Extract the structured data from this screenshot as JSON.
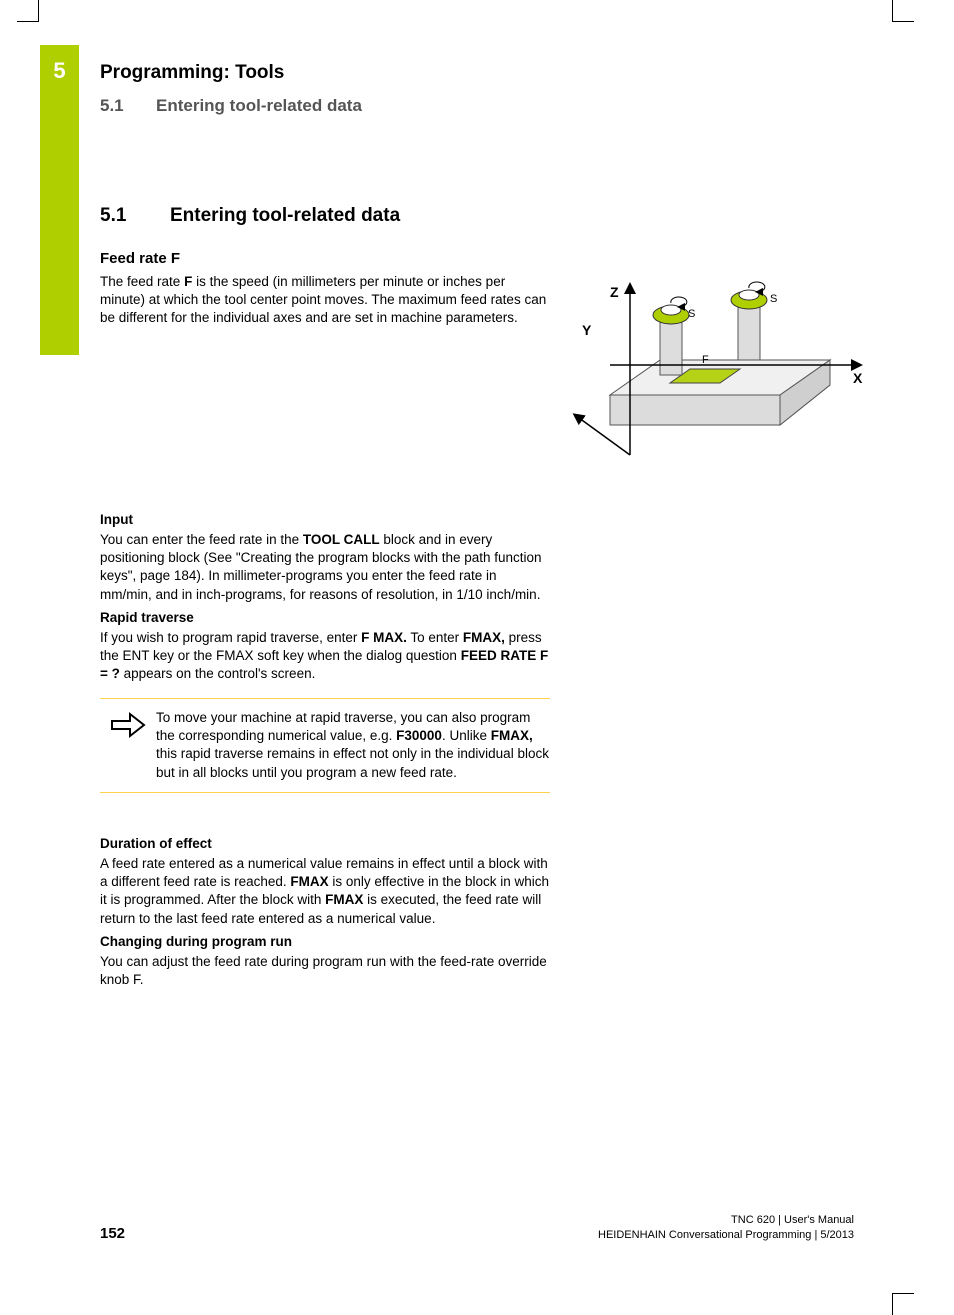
{
  "chapter": {
    "number": "5",
    "title": "Programming: Tools"
  },
  "section_head": {
    "num": "5.1",
    "title": "Entering tool-related data"
  },
  "section_repeat": {
    "num": "5.1",
    "title": "Entering tool-related data"
  },
  "feed": {
    "heading": "Feed rate F",
    "para_a": "The feed rate ",
    "para_b": "F",
    "para_c": " is the speed (in millimeters per minute or inches per minute) at which the tool center point moves. The maximum feed rates can be different for the individual axes and are set in machine parameters."
  },
  "diagram": {
    "x": "X",
    "y": "Y",
    "z": "Z",
    "s": "S",
    "f": "F"
  },
  "input": {
    "heading": "Input",
    "p1a": "You can enter the feed rate in the ",
    "p1b": "TOOL CALL",
    "p1c": " block and in every positioning block (See \"Creating the program blocks with the path function keys\", page 184). In millimeter-programs you enter the feed rate in mm/min, and in inch-programs, for reasons of resolution, in 1/10 inch/min."
  },
  "rapid": {
    "heading": "Rapid traverse",
    "p1a": "If you wish to program rapid traverse, enter ",
    "p1b": "F MAX.",
    "p1c": " To enter ",
    "p1d": "FMAX,",
    "p1e": " press the ENT key or the FMAX soft key when the dialog question ",
    "p1f": "FEED RATE F = ?",
    "p1g": " appears on the control's screen."
  },
  "note": {
    "a": "To move your machine at rapid traverse, you can also program the corresponding numerical value, e.g. ",
    "b": "F30000",
    "c": ". Unlike ",
    "d": "FMAX,",
    "e": " this rapid traverse remains in effect not only in the individual block but in all blocks until you program a new feed rate."
  },
  "duration": {
    "heading": "Duration of effect",
    "p1a": "A feed rate entered as a numerical value remains in effect until a block with a different feed rate is reached. ",
    "p1b": "FMAX",
    "p1c": " is only effective in the block in which it is programmed. After the block with ",
    "p1d": "FMAX",
    "p1e": " is executed, the feed rate will return to the last feed rate entered as a numerical value."
  },
  "changing": {
    "heading": "Changing during program run",
    "p1": "You can adjust the feed rate during program run with the feed-rate override knob F."
  },
  "footer": {
    "page": "152",
    "line1": "TNC 620 | User's Manual",
    "line2": "HEIDENHAIN Conversational Programming | 5/2013"
  }
}
